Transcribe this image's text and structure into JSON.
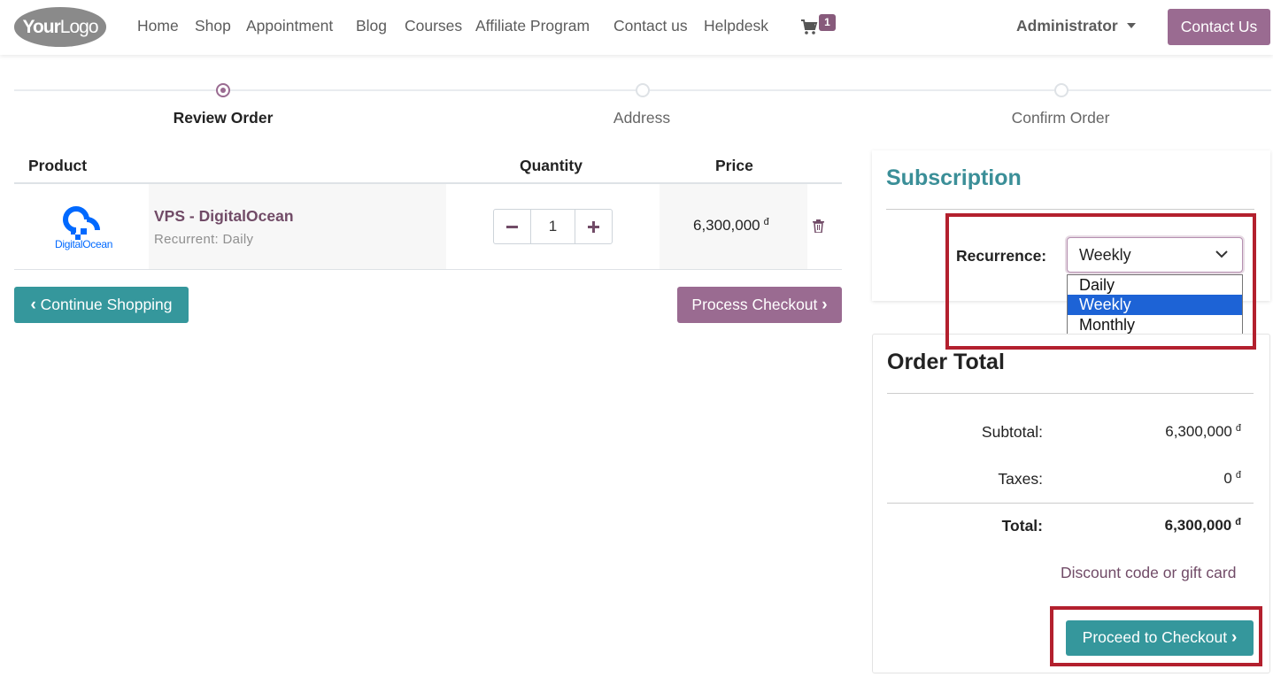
{
  "header": {
    "logo_your": "Your",
    "logo_logo": "Logo",
    "nav": [
      "Home",
      "Shop",
      "Appointment",
      "Blog",
      "Courses",
      "Affiliate Program",
      "Contact us",
      "Helpdesk"
    ],
    "cart_count": "1",
    "user": "Administrator",
    "contact_button": "Contact Us"
  },
  "steps": [
    {
      "label": "Review Order",
      "active": true
    },
    {
      "label": "Address",
      "active": false
    },
    {
      "label": "Confirm Order",
      "active": false
    }
  ],
  "table": {
    "headers": {
      "product": "Product",
      "quantity": "Quantity",
      "price": "Price"
    },
    "rows": [
      {
        "logo_text": "DigitalOcean",
        "name": "VPS - DigitalOcean",
        "subtitle": "Recurrent: Daily",
        "quantity": "1",
        "price": "6,300,000",
        "currency": "đ"
      }
    ]
  },
  "buttons": {
    "continue_shopping": "Continue Shopping",
    "process_checkout": "Process Checkout",
    "proceed_checkout": "Proceed to Checkout"
  },
  "subscription": {
    "title": "Subscription",
    "recurrence_label": "Recurrence:",
    "selected": "Weekly",
    "options": [
      "Daily",
      "Weekly",
      "Monthly"
    ]
  },
  "order_total": {
    "title": "Order Total",
    "subtotal_label": "Subtotal:",
    "subtotal": "6,300,000",
    "taxes_label": "Taxes:",
    "taxes": "0",
    "total_label": "Total:",
    "total": "6,300,000",
    "currency": "đ",
    "discount_link": "Discount code or gift card"
  },
  "colors": {
    "primary_purple": "#9a6b91",
    "teal": "#35979c",
    "highlight_red": "#b3202e",
    "select_blue": "#1d63d6"
  }
}
